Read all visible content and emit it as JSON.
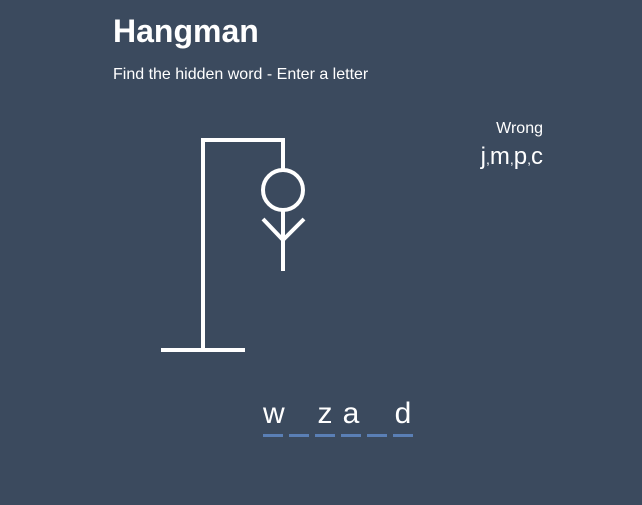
{
  "header": {
    "title": "Hangman",
    "subtitle": "Find the hidden word - Enter a letter"
  },
  "wrong": {
    "label": "Wrong",
    "letters": [
      "j",
      "m",
      "p",
      "c"
    ]
  },
  "word": {
    "slots": [
      "w",
      "",
      "z",
      "a",
      "",
      "d"
    ]
  },
  "colors": {
    "background": "#3b4a5e",
    "foreground": "#ffffff",
    "underline": "#5a7fb5"
  },
  "figure": {
    "parts_drawn": [
      "gallows-base",
      "gallows-post",
      "gallows-beam",
      "rope",
      "head",
      "body",
      "left-arm",
      "right-arm"
    ]
  }
}
